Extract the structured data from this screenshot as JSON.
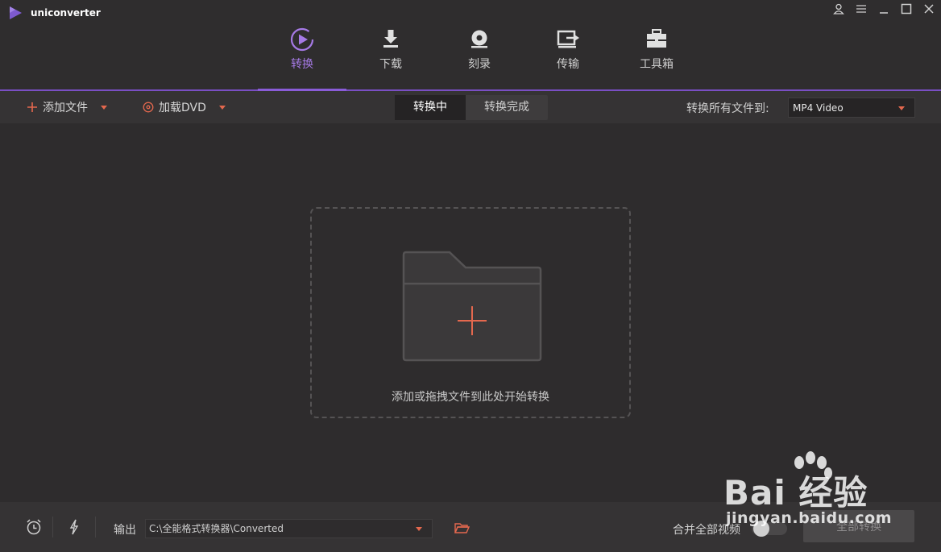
{
  "app": {
    "title": "uniconverter"
  },
  "nav": {
    "items": [
      {
        "label": "转换",
        "icon": "convert-icon",
        "active": true
      },
      {
        "label": "下载",
        "icon": "download-icon",
        "active": false
      },
      {
        "label": "刻录",
        "icon": "burn-disc-icon",
        "active": false
      },
      {
        "label": "传输",
        "icon": "transfer-icon",
        "active": false
      },
      {
        "label": "工具箱",
        "icon": "toolbox-icon",
        "active": false
      }
    ]
  },
  "toolbar": {
    "add_file_label": "添加文件",
    "load_dvd_label": "加载DVD",
    "tabs": [
      {
        "label": "转换中",
        "active": true
      },
      {
        "label": "转换完成",
        "active": false
      }
    ],
    "convert_all_to_label": "转换所有文件到:",
    "format_value": "MP4 Video"
  },
  "main": {
    "drop_text": "添加或拖拽文件到此处开始转换"
  },
  "bottom": {
    "output_label": "输出",
    "output_path": "C:\\全能格式转换器\\Converted",
    "merge_label": "合并全部视频",
    "convert_all_button": "全部转换"
  },
  "watermark": {
    "text": "Bai 经验",
    "sub": "jingyan.baidu.com"
  },
  "colors": {
    "accent_purple": "#8a5cd8",
    "accent_orange": "#e4684e",
    "background": "#2e2c2d"
  }
}
